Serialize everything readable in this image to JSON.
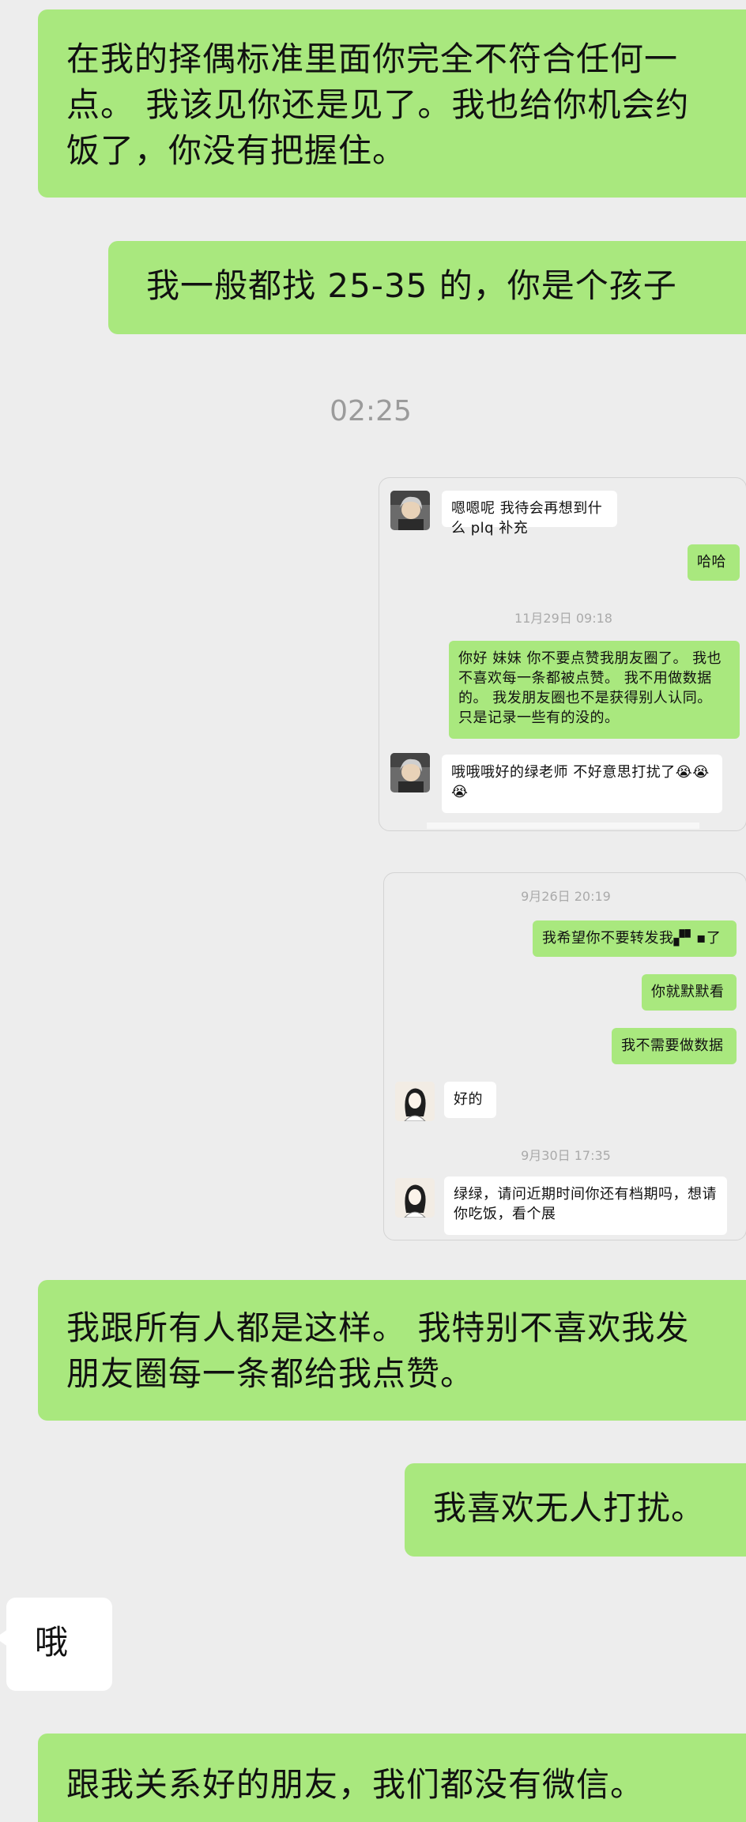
{
  "messages": {
    "m1": "在我的择偶标准里面你完全不符合任何一点。 我该见你还是见了。我也给你机会约饭了，你没有把握住。",
    "m2": "我一般都找 25-35 的，你是个孩子",
    "time1": "02:25",
    "m3": "我跟所有人都是这样。 我特别不喜欢我发朋友圈每一条都给我点赞。",
    "m4": "我喜欢无人打扰。",
    "m5": "哦",
    "m6": "跟我关系好的朋友，我们都没有微信。"
  },
  "screenshot1": {
    "msg1": "嗯嗯呢 我待会再想到什么 plq 补充",
    "msg2": "哈哈",
    "time": "11月29日 09:18",
    "msg3": "你好 妹妹 你不要点赞我朋友圈了。 我也不喜欢每一条都被点赞。 我不用做数据的。 我发朋友圈也不是获得别人认同。 只是记录一些有的没的。",
    "msg4": "哦哦哦好的绿老师 不好意思打扰了😭😭😭"
  },
  "screenshot2": {
    "time1": "9月26日 20:19",
    "msg1": "我希望你不要转发我▞▘▪了",
    "msg2": "你就默默看",
    "msg3": "我不需要做数据",
    "msg4": "好的",
    "time2": "9月30日 17:35",
    "msg5": "绿绿，请问近期时间你还有档期吗，想请你吃饭，看个展"
  },
  "colors": {
    "background": "#ededed",
    "sent_bubble": "#a9e87e",
    "received_bubble": "#ffffff",
    "timestamp": "#9b9b9b"
  },
  "icons": {
    "avatar1": "photo-avatar-icon",
    "avatar2": "illustrated-girl-avatar-icon"
  }
}
